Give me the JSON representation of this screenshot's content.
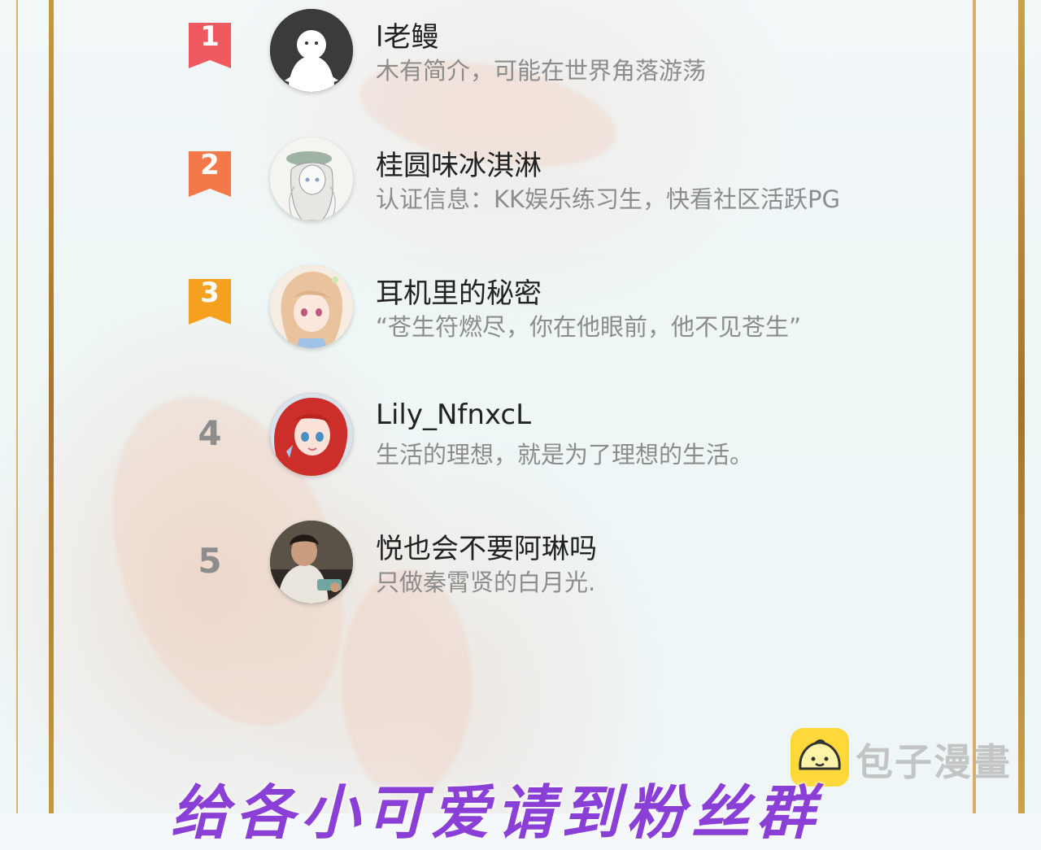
{
  "fans": [
    {
      "rank": "1",
      "rank_color": "#ee5a5f",
      "name": "l老鳗",
      "bio": "木有简介，可能在世界角落游荡",
      "avatar": "default-ghost-avatar"
    },
    {
      "rank": "2",
      "rank_color": "#f3784a",
      "name": "桂圆味冰淇淋",
      "bio": "认证信息：KK娱乐练习生，快看社区活跃PG",
      "avatar": "sketch-girl-avatar"
    },
    {
      "rank": "3",
      "rank_color": "#f5a11f",
      "name": "耳机里的秘密",
      "bio": "“苍生符燃尽，你在他眼前，他不见苍生”",
      "avatar": "anime-blonde-girl-avatar"
    },
    {
      "rank": "4",
      "name": "Lily_NfnxcL",
      "bio": "生活的理想，就是为了理想的生活。",
      "avatar": "red-hair-girl-avatar"
    },
    {
      "rank": "5",
      "name": "悦也会不要阿琳吗",
      "bio": "只做秦霄贤的白月光.",
      "avatar": "photo-man-avatar"
    }
  ],
  "watermark": {
    "text": "包子漫畫",
    "logo_color": "#ffd83a"
  },
  "bottom_banner": {
    "text": "给各小可爱请到粉丝群"
  }
}
